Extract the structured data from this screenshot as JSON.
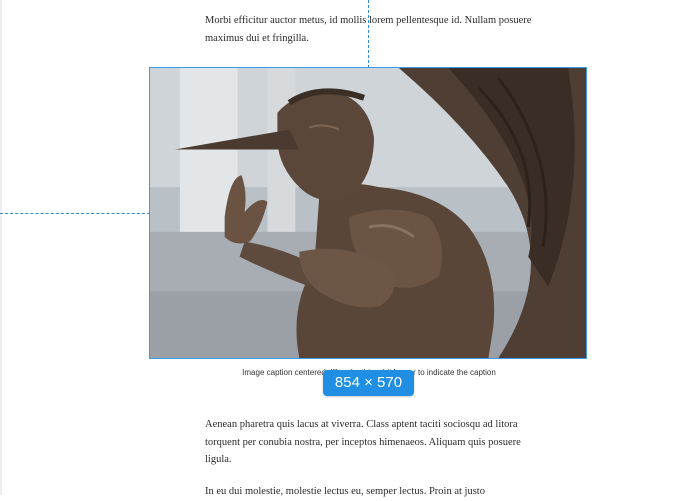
{
  "content": {
    "paragraph_1": "Morbi efficitur auctor metus, id mollis lorem pellentesque id. Nullam posuere maximus dui et fringilla.",
    "paragraph_2": "Aenean pharetra quis lacus at viverra. Class aptent taciti sociosqu ad litora torquent per conubia nostra, per inceptos himenaeos. Aliquam quis posuere ligula.",
    "paragraph_3": "In eu dui molestie, molestie lectus eu, semper lectus. Proin at justo"
  },
  "image": {
    "caption": "Image caption centered. I'll make this a bit longer to indicate the caption height.",
    "size_badge": "854 × 570",
    "subject": "bronze-sculpture-long-nosed-winged-figure"
  },
  "colors": {
    "guide": "#2f8ddb",
    "selection": "#3a9bea",
    "badge_bg": "#1f8ee3",
    "text": "#2b2b2b"
  }
}
